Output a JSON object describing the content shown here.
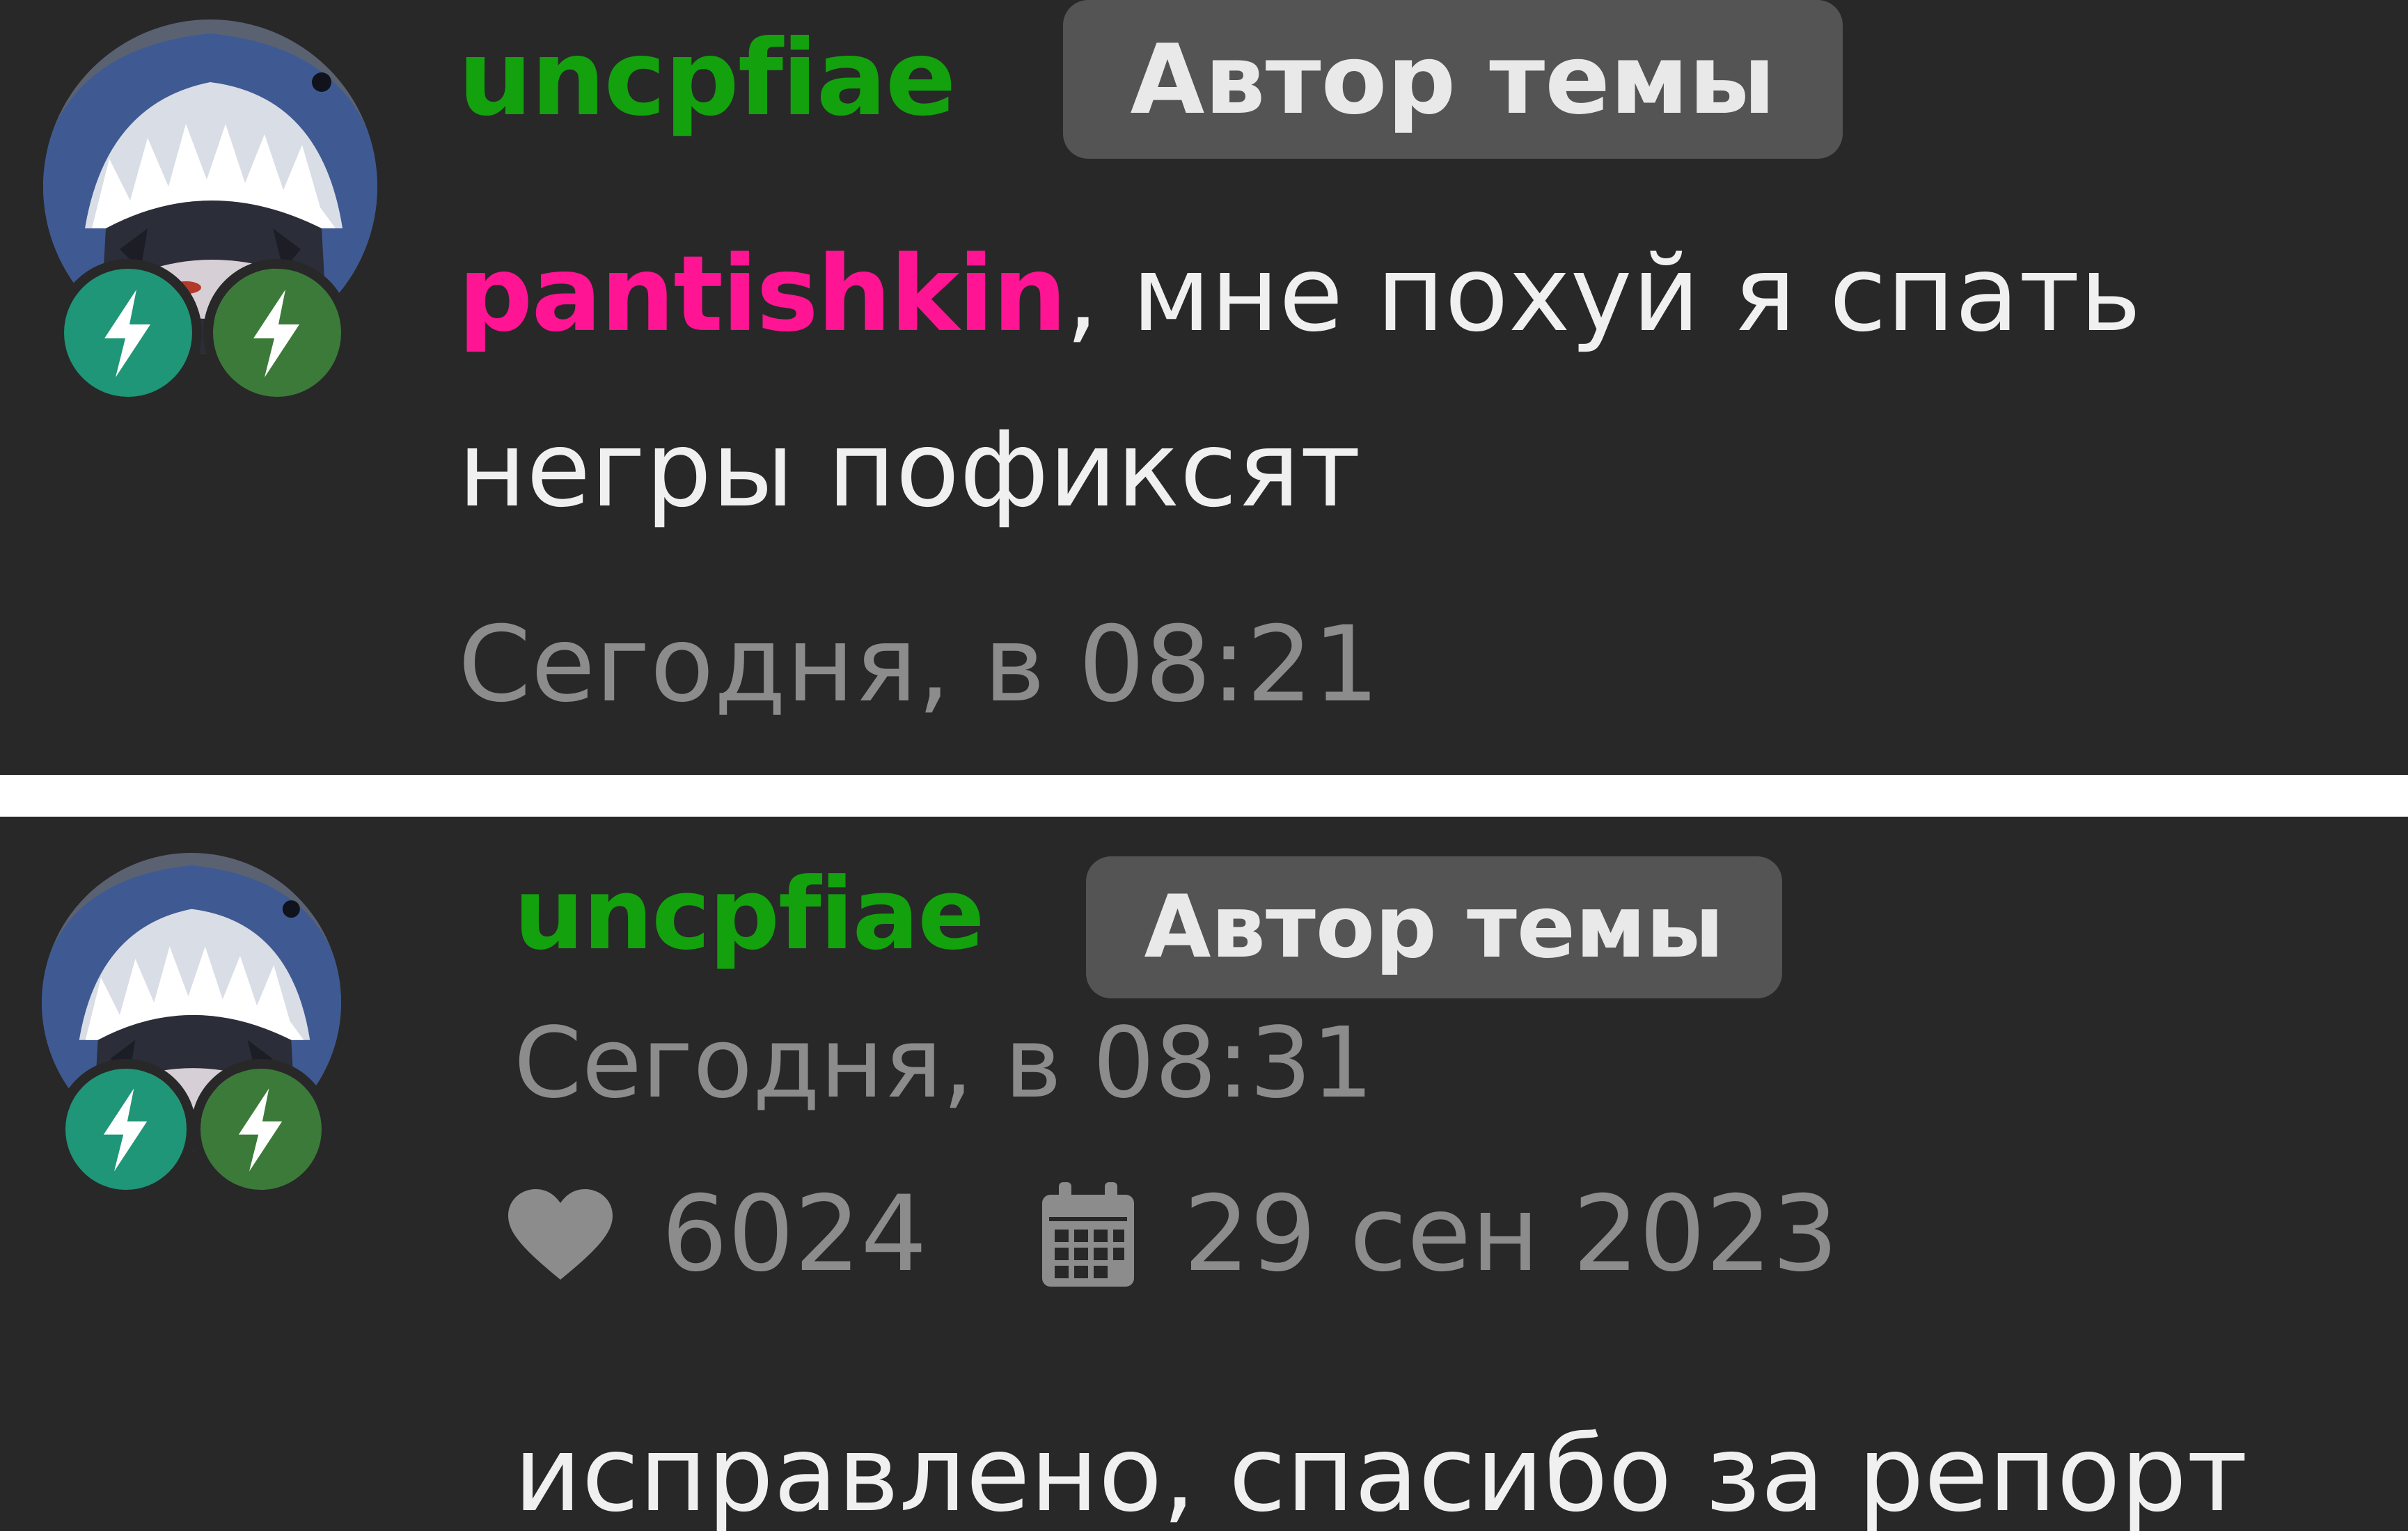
{
  "colors": {
    "background": "#282828",
    "divider": "#ffffff",
    "username": "#13a10e",
    "mention": "#ff1493",
    "tag_bg": "#545454",
    "text": "#f0f0f0",
    "muted": "#8c8c8c",
    "badge_teal": "#1e9677",
    "badge_green": "#3c7a3a"
  },
  "posts": [
    {
      "username": "uncpfiae",
      "author_tag": "Автор темы",
      "avatar_icon": "anime-shark-hood-avatar",
      "badges": [
        "lightning-badge-icon",
        "lightning-badge-icon"
      ],
      "mention": "pantishkin",
      "message_line1_rest": ", мне похуй я спать",
      "message_line2": "негры пофиксят",
      "timestamp": "Сегодня, в 08:21"
    },
    {
      "username": "uncpfiae",
      "author_tag": "Автор темы",
      "avatar_icon": "anime-shark-hood-avatar",
      "badges": [
        "lightning-badge-icon",
        "lightning-badge-icon"
      ],
      "timestamp": "Сегодня, в 08:31",
      "likes_icon": "heart-icon",
      "likes": "6024",
      "joined_icon": "calendar-icon",
      "joined": "29 сен 2023",
      "message": "исправлено, спасибо за репорт"
    }
  ]
}
